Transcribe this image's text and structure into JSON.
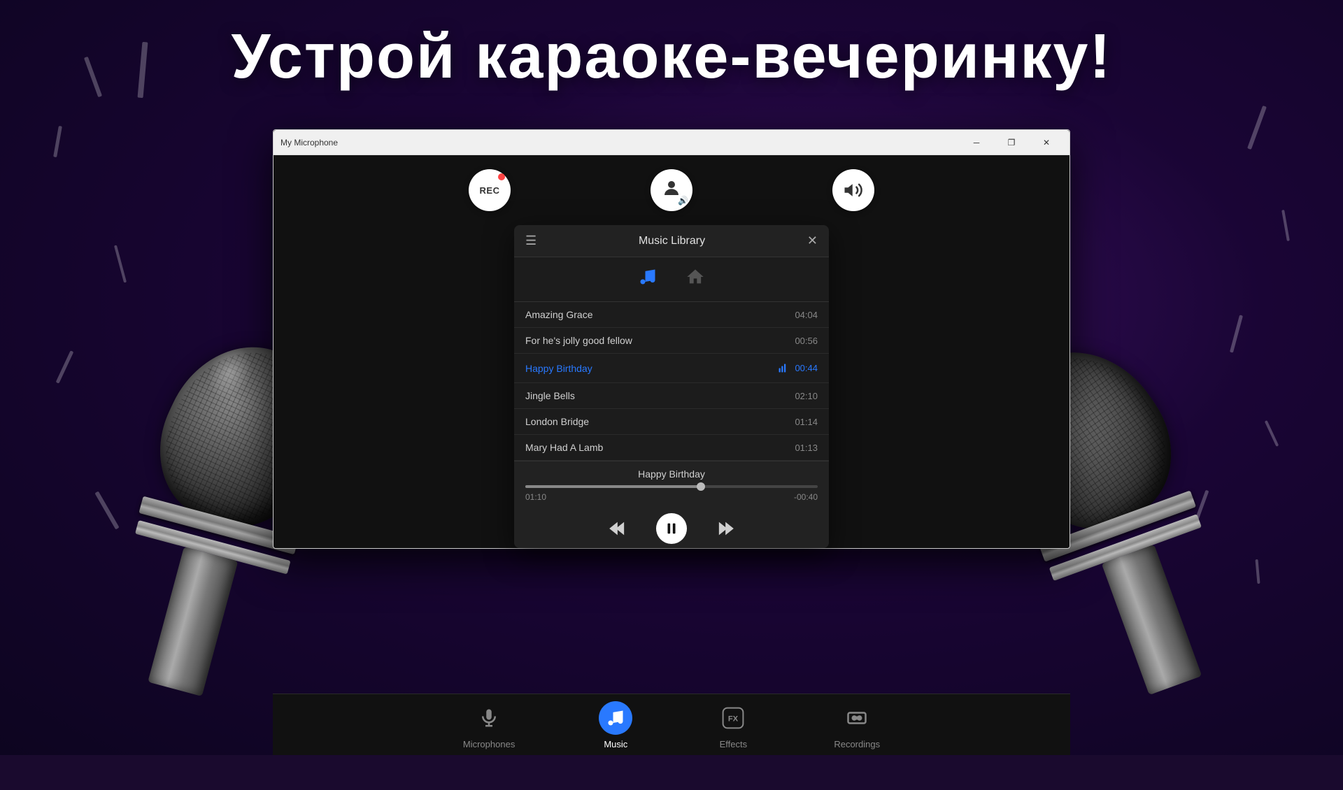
{
  "page": {
    "title": "Устрой караоке-вечеринку!",
    "bg_color": "#1a0a2e"
  },
  "window": {
    "title": "My Microphone",
    "minimize_label": "─",
    "restore_label": "❐",
    "close_label": "✕"
  },
  "top_controls": {
    "rec_label": "REC",
    "person_icon": "👤",
    "volume_icon": "🔊"
  },
  "music_panel": {
    "title": "Music Library",
    "menu_icon": "☰",
    "close_icon": "✕",
    "tabs": [
      {
        "label": "♪",
        "active": true,
        "name": "music-tab"
      },
      {
        "label": "⌂",
        "active": false,
        "name": "home-tab"
      }
    ],
    "songs": [
      {
        "name": "Amazing Grace",
        "duration": "04:04",
        "playing": false
      },
      {
        "name": "For he's  jolly good fellow",
        "duration": "00:56",
        "playing": false
      },
      {
        "name": "Happy Birthday",
        "duration": "00:44",
        "playing": true
      },
      {
        "name": "Jingle Bells",
        "duration": "02:10",
        "playing": false
      },
      {
        "name": "London Bridge",
        "duration": "01:14",
        "playing": false
      },
      {
        "name": "Mary Had A Lamb",
        "duration": "01:13",
        "playing": false
      }
    ],
    "now_playing": {
      "title": "Happy Birthday",
      "time_elapsed": "01:10",
      "time_remaining": "-00:40",
      "progress_percent": 60
    }
  },
  "bottom_nav": {
    "items": [
      {
        "label": "Microphones",
        "icon": "🎙",
        "active": false,
        "name": "nav-microphones"
      },
      {
        "label": "Music",
        "icon": "♪",
        "active": true,
        "name": "nav-music"
      },
      {
        "label": "Effects",
        "icon": "FX",
        "active": false,
        "name": "nav-effects"
      },
      {
        "label": "Recordings",
        "icon": "⏺",
        "active": false,
        "name": "nav-recordings"
      }
    ]
  }
}
